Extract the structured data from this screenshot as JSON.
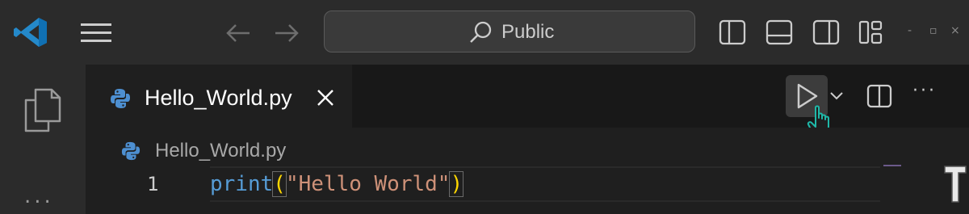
{
  "titlebar": {
    "search_text": "Public",
    "window_controls": {
      "minimize": "-",
      "restore": "▫",
      "close": "×"
    }
  },
  "tab": {
    "label": "Hello_World.py",
    "close": "✕"
  },
  "breadcrumb": {
    "file": "Hello_World.py"
  },
  "editor": {
    "line_number": "1",
    "code": {
      "fn": "print",
      "open_paren": "(",
      "string": "\"Hello World\"",
      "close_paren": ")"
    }
  },
  "activitybar": {
    "more": "..."
  },
  "editor_actions": {
    "more": "···"
  },
  "icons": {
    "logo": "vscode-logo-icon",
    "menu": "hamburger-menu-icon",
    "back": "arrow-left-icon",
    "forward": "arrow-right-icon",
    "search": "search-icon",
    "explorer": "files-icon",
    "python": "python-icon",
    "run": "play-icon",
    "split": "split-editor-icon",
    "cursor": "hand-pointer-icon"
  },
  "colors": {
    "accent": "#3a9ae6",
    "keyword": "#569cd6",
    "string": "#ce9178",
    "bracket": "#ffd700",
    "hand_cursor": "#1fb8a8"
  }
}
